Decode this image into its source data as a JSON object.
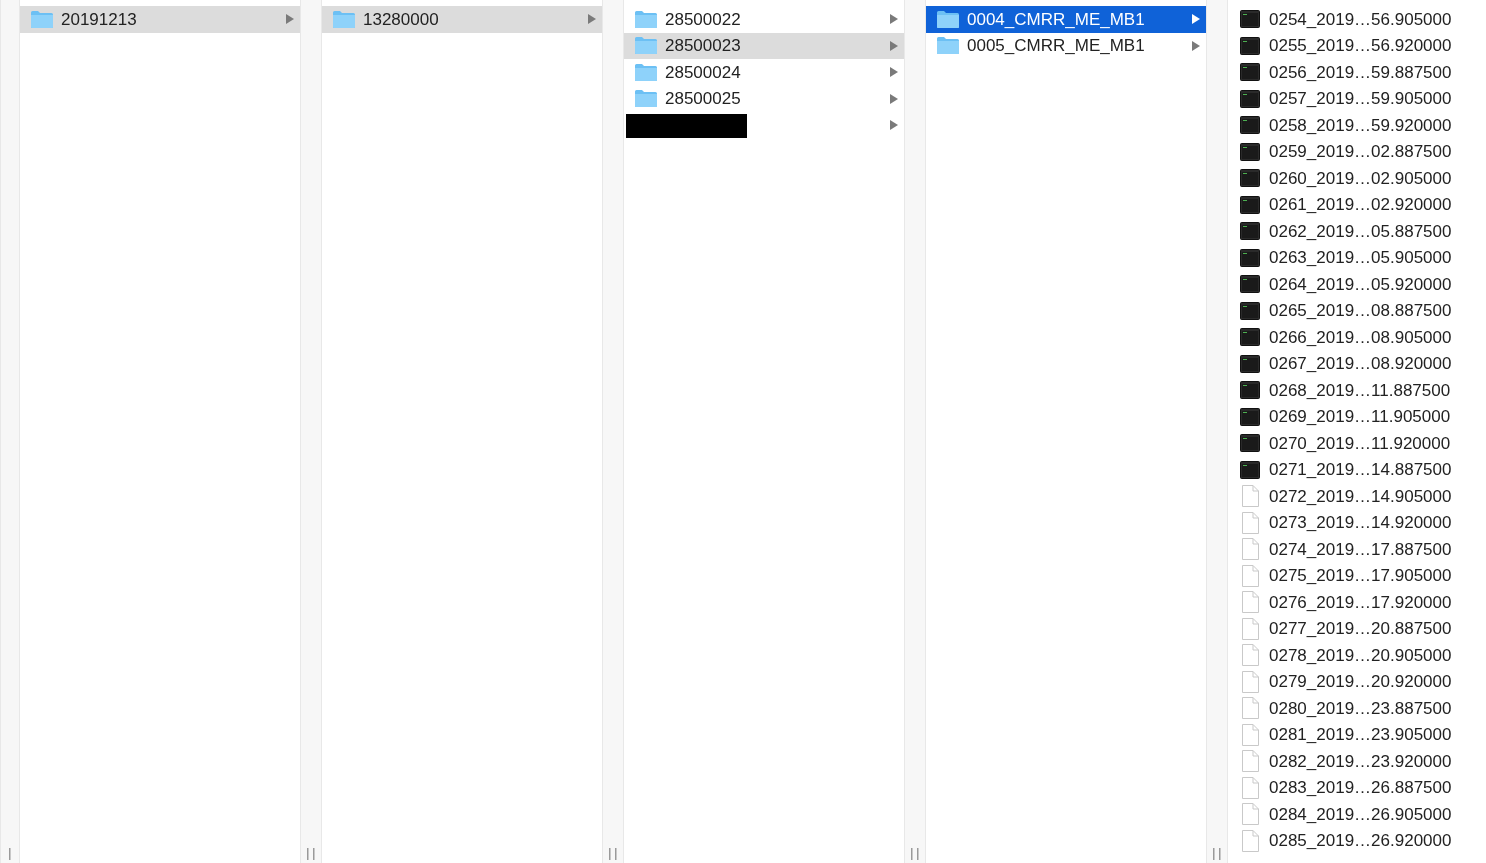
{
  "columns": [
    {
      "focused": false,
      "items": [
        {
          "kind": "folder",
          "name": "20191213",
          "selected": true
        }
      ]
    },
    {
      "focused": false,
      "items": [
        {
          "kind": "folder",
          "name": "13280000",
          "selected": true
        }
      ]
    },
    {
      "focused": false,
      "items": [
        {
          "kind": "folder",
          "name": "28500022",
          "selected": false
        },
        {
          "kind": "folder",
          "name": "28500023",
          "selected": true
        },
        {
          "kind": "folder",
          "name": "28500024",
          "selected": false
        },
        {
          "kind": "folder",
          "name": "28500025",
          "selected": false
        },
        {
          "kind": "redacted",
          "selected": false
        }
      ]
    },
    {
      "focused": true,
      "items": [
        {
          "kind": "folder",
          "name": "0004_CMRR_ME_MB1",
          "selected": true
        },
        {
          "kind": "folder",
          "name": "0005_CMRR_ME_MB1",
          "selected": false
        }
      ]
    },
    {
      "items": [
        {
          "kind": "executable",
          "name": "0254_2019…56.905000",
          "selected": false
        },
        {
          "kind": "executable",
          "name": "0255_2019…56.920000",
          "selected": false
        },
        {
          "kind": "executable",
          "name": "0256_2019…59.887500",
          "selected": false
        },
        {
          "kind": "executable",
          "name": "0257_2019…59.905000",
          "selected": false
        },
        {
          "kind": "executable",
          "name": "0258_2019…59.920000",
          "selected": false
        },
        {
          "kind": "executable",
          "name": "0259_2019…02.887500",
          "selected": false
        },
        {
          "kind": "executable",
          "name": "0260_2019…02.905000",
          "selected": false
        },
        {
          "kind": "executable",
          "name": "0261_2019…02.920000",
          "selected": false
        },
        {
          "kind": "executable",
          "name": "0262_2019…05.887500",
          "selected": false
        },
        {
          "kind": "executable",
          "name": "0263_2019…05.905000",
          "selected": false
        },
        {
          "kind": "executable",
          "name": "0264_2019…05.920000",
          "selected": false
        },
        {
          "kind": "executable",
          "name": "0265_2019…08.887500",
          "selected": false
        },
        {
          "kind": "executable",
          "name": "0266_2019…08.905000",
          "selected": false
        },
        {
          "kind": "executable",
          "name": "0267_2019…08.920000",
          "selected": false
        },
        {
          "kind": "executable",
          "name": "0268_2019…11.887500",
          "selected": false
        },
        {
          "kind": "executable",
          "name": "0269_2019…11.905000",
          "selected": false
        },
        {
          "kind": "executable",
          "name": "0270_2019…11.920000",
          "selected": false
        },
        {
          "kind": "executable",
          "name": "0271_2019…14.887500",
          "selected": false
        },
        {
          "kind": "document",
          "name": "0272_2019…14.905000",
          "selected": false
        },
        {
          "kind": "document",
          "name": "0273_2019…14.920000",
          "selected": false
        },
        {
          "kind": "document",
          "name": "0274_2019…17.887500",
          "selected": false
        },
        {
          "kind": "document",
          "name": "0275_2019…17.905000",
          "selected": false
        },
        {
          "kind": "document",
          "name": "0276_2019…17.920000",
          "selected": false
        },
        {
          "kind": "document",
          "name": "0277_2019…20.887500",
          "selected": false
        },
        {
          "kind": "document",
          "name": "0278_2019…20.905000",
          "selected": false
        },
        {
          "kind": "document",
          "name": "0279_2019…20.920000",
          "selected": false
        },
        {
          "kind": "document",
          "name": "0280_2019…23.887500",
          "selected": false
        },
        {
          "kind": "document",
          "name": "0281_2019…23.905000",
          "selected": false
        },
        {
          "kind": "document",
          "name": "0282_2019…23.920000",
          "selected": false
        },
        {
          "kind": "document",
          "name": "0283_2019…26.887500",
          "selected": false
        },
        {
          "kind": "document",
          "name": "0284_2019…26.905000",
          "selected": false
        },
        {
          "kind": "document",
          "name": "0285_2019…26.920000",
          "selected": false
        }
      ]
    }
  ]
}
